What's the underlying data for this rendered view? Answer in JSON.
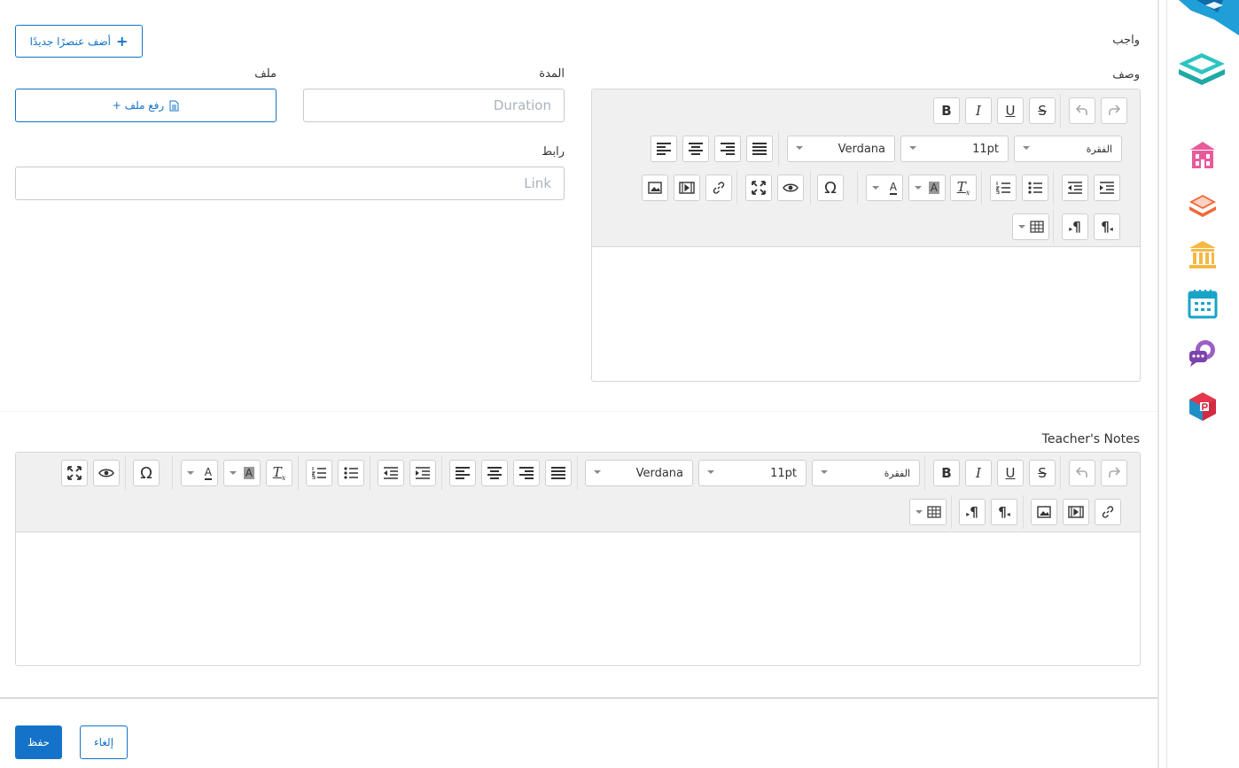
{
  "header": {
    "add_item_label": "أضف عنصرًا جديدًا",
    "section_title": "واجب"
  },
  "form": {
    "description_label": "وصف",
    "duration_label": "المدة",
    "duration_placeholder": "Duration",
    "file_label": "ملف",
    "upload_label": "+ رفع ملف",
    "link_label": "رابط",
    "link_placeholder": "Link",
    "teacher_notes_label": "Teacher's Notes"
  },
  "editor": {
    "font_name": "Verdana",
    "font_size": "11pt",
    "block_format": "الفقرة",
    "bold": "B",
    "italic": "I",
    "underline": "U",
    "strike": "S",
    "omega": "Ω"
  },
  "footer": {
    "save_label": "حفظ",
    "cancel_label": "إلغاء"
  },
  "colors": {
    "primary": "#1473c8",
    "toolbar_bg": "#f0f0f0",
    "border": "#d6d6d6"
  },
  "sidebar": {
    "icons": [
      "logo-ribbon-icon",
      "book-stack-logo-icon",
      "school-building-icon",
      "books-icon",
      "institution-icon",
      "calendar-icon",
      "chat-bubbles-icon",
      "package-icon"
    ]
  }
}
